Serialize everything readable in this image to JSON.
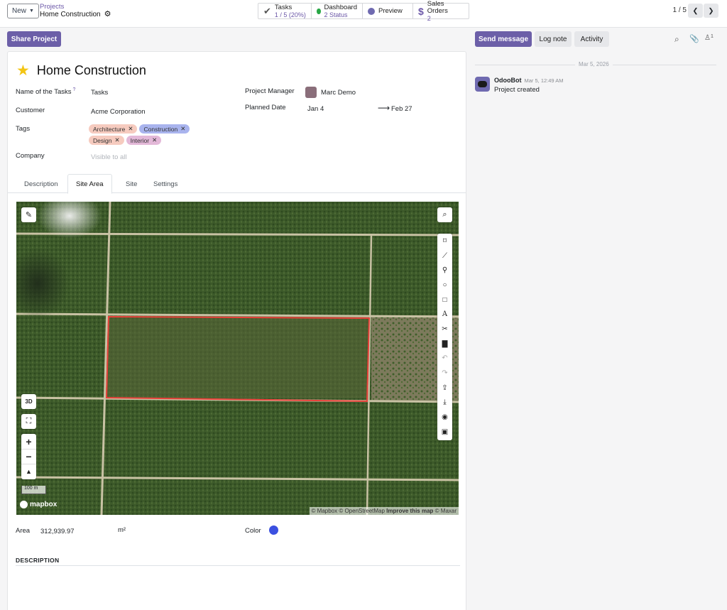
{
  "topbar": {
    "new_label": "New",
    "breadcrumb_parent": "Projects",
    "breadcrumb_current": "Home Construction",
    "smart_buttons": [
      {
        "title": "Tasks",
        "sub": "1 / 5 (20%)"
      },
      {
        "title": "Dashboard",
        "sub": "2 Status"
      },
      {
        "title": "Preview",
        "sub": ""
      },
      {
        "title": "Sales Orders",
        "sub": "2"
      }
    ],
    "pager": "1 / 5"
  },
  "share_label": "Share Project",
  "project": {
    "name": "Home Construction",
    "fields": {
      "tasks_label": "Name of the Tasks",
      "tasks_help": "?",
      "tasks_value": "Tasks",
      "customer_label": "Customer",
      "customer_value": "Acme Corporation",
      "tags_label": "Tags",
      "company_label": "Company",
      "company_placeholder": "Visible to all",
      "manager_label": "Project Manager",
      "manager_value": "Marc Demo",
      "planned_label": "Planned Date",
      "planned_start": "Jan 4",
      "planned_end": "Feb 27"
    },
    "tags": [
      {
        "label": "Architecture",
        "color": "#f6cbbf"
      },
      {
        "label": "Construction",
        "color": "#a9b4ee"
      },
      {
        "label": "Design",
        "color": "#f6cbbf"
      },
      {
        "label": "Interior",
        "color": "#e3b8d8"
      }
    ]
  },
  "tabs": [
    "Description",
    "Site Area",
    "Site",
    "Settings"
  ],
  "map": {
    "btn_3d": "3D",
    "scale": "100 m",
    "logo": "mapbox",
    "attribution": [
      "© Mapbox",
      "© OpenStreetMap",
      "Improve this map",
      "© Maxar"
    ],
    "tools": [
      "polygon-tool-icon",
      "line-tool-icon",
      "marker-tool-icon",
      "circle-tool-icon",
      "rectangle-tool-icon",
      "text-tool-icon",
      "cut-tool-icon",
      "delete-icon",
      "undo-icon",
      "redo-icon",
      "upload-icon",
      "download-icon",
      "hide-icon",
      "save-icon"
    ]
  },
  "area": {
    "label": "Area",
    "value": "312,939.97",
    "unit": "m²",
    "color_label": "Color",
    "color": "#3b50e0"
  },
  "description_heading": "DESCRIPTION",
  "chatter": {
    "send_label": "Send message",
    "log_label": "Log note",
    "activity_label": "Activity",
    "followers": "1",
    "date_divider": "Mar 5, 2026",
    "author": "OdooBot",
    "time": "Mar 5, 12:49 AM",
    "body": "Project created"
  }
}
